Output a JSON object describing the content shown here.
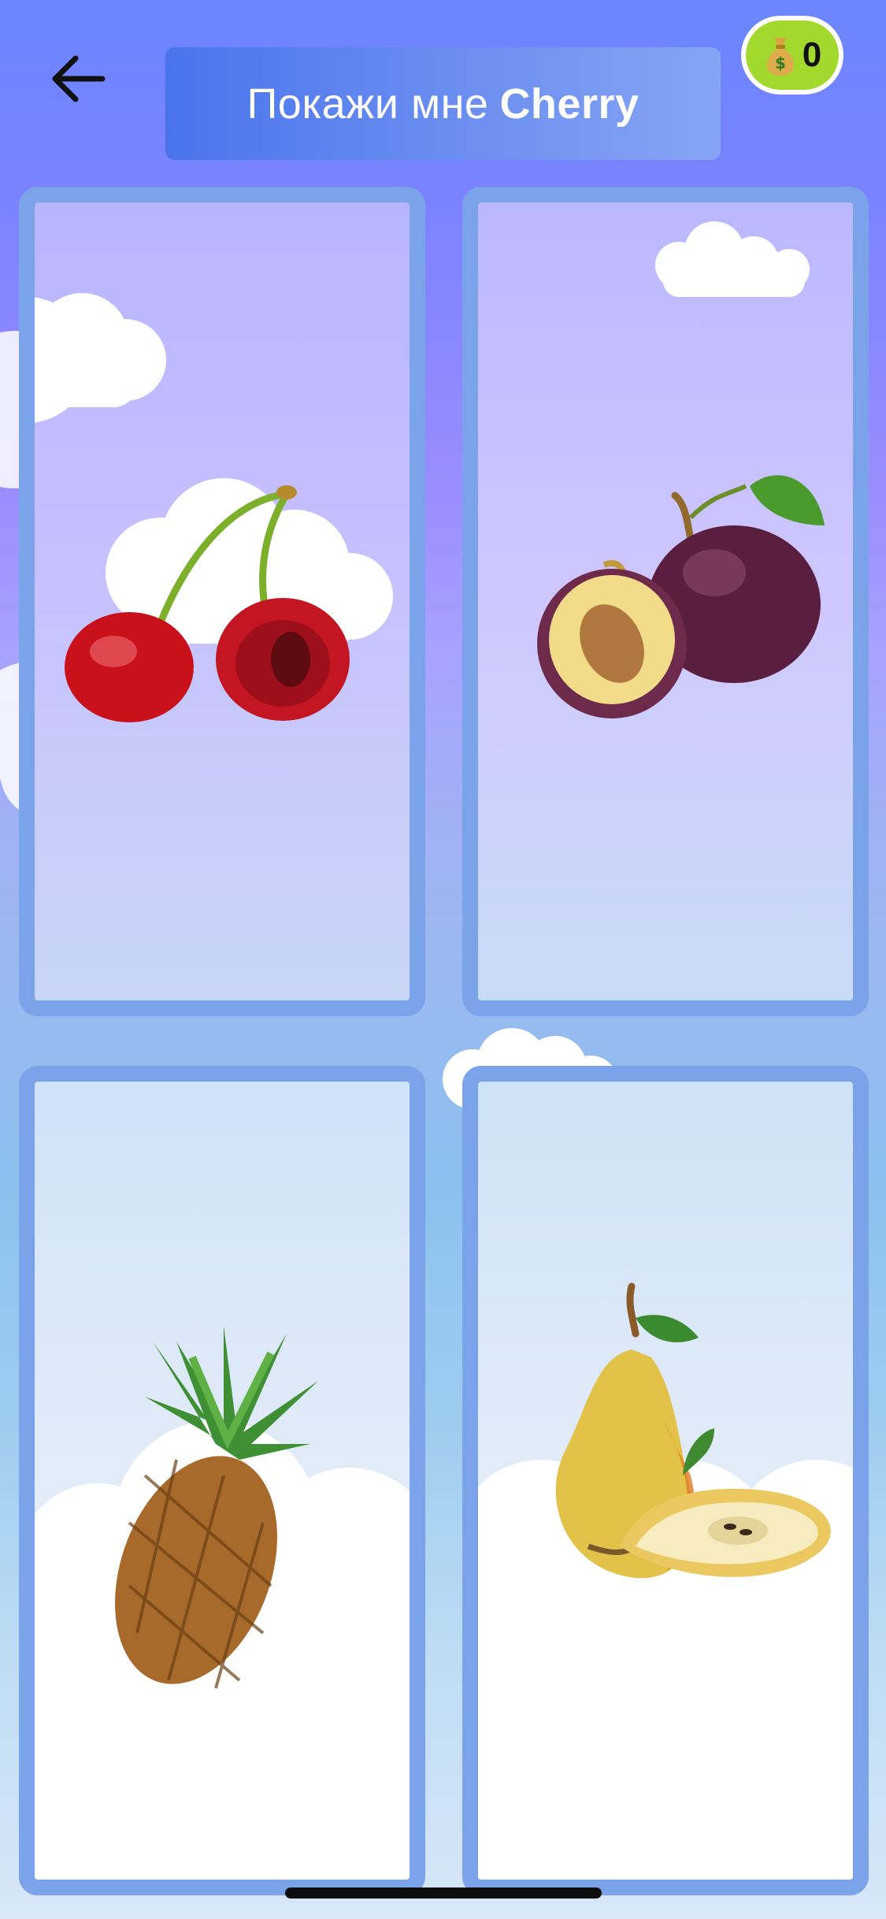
{
  "header": {
    "prompt_prefix": "Покажи мне",
    "prompt_word": "Cherry",
    "back_icon": "arrow-left-icon"
  },
  "coins": {
    "icon": "money-bag-icon",
    "count": "0",
    "badge_color": "#a3d82c"
  },
  "cards": [
    {
      "fruit": "cherry",
      "icon": "cherry-icon"
    },
    {
      "fruit": "plum",
      "icon": "plum-icon"
    },
    {
      "fruit": "pineapple",
      "icon": "pineapple-icon"
    },
    {
      "fruit": "pear",
      "icon": "pear-icon"
    }
  ],
  "colors": {
    "card_border": "#7aa3ea",
    "banner": "#4a74ec"
  }
}
